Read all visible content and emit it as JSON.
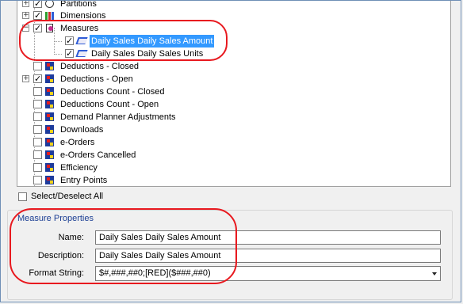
{
  "tree": {
    "items": [
      {
        "label": "Partitions"
      },
      {
        "label": "Dimensions"
      },
      {
        "label": "Measures"
      },
      {
        "label": "Daily Sales Daily Sales Amount"
      },
      {
        "label": "Daily Sales Daily Sales Units"
      },
      {
        "label": "Deductions - Closed"
      },
      {
        "label": "Deductions - Open"
      },
      {
        "label": "Deductions Count - Closed"
      },
      {
        "label": "Deductions Count - Open"
      },
      {
        "label": "Demand Planner Adjustments"
      },
      {
        "label": "Downloads"
      },
      {
        "label": "e-Orders"
      },
      {
        "label": "e-Orders Cancelled"
      },
      {
        "label": "Efficiency"
      },
      {
        "label": "Entry Points"
      }
    ]
  },
  "select_all": {
    "label": "Select/Deselect All"
  },
  "measure_properties": {
    "title": "Measure Properties",
    "name_label": "Name:",
    "name_value": "Daily Sales Daily Sales Amount",
    "description_label": "Description:",
    "description_value": "Daily Sales Daily Sales Amount",
    "format_label": "Format String:",
    "format_value": "$#,###,##0;[RED]($###,##0)"
  },
  "colors": {
    "selection": "#3399ff",
    "highlight_circle": "#e8191f"
  }
}
